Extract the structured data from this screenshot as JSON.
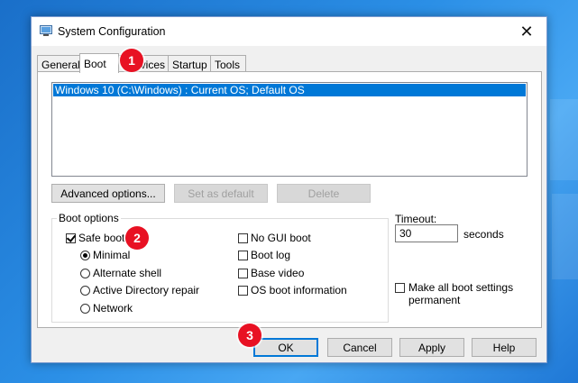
{
  "window": {
    "title": "System Configuration",
    "close_glyph": "✕"
  },
  "tabs": [
    {
      "label": "General",
      "active": false
    },
    {
      "label": "Boot",
      "active": true
    },
    {
      "label": "Services",
      "active": false
    },
    {
      "label": "Startup",
      "active": false
    },
    {
      "label": "Tools",
      "active": false
    }
  ],
  "os_list": {
    "items": [
      "Windows 10 (C:\\Windows) : Current OS; Default OS"
    ],
    "selected_index": 0
  },
  "buttons": {
    "advanced": "Advanced options...",
    "set_default": "Set as default",
    "delete": "Delete"
  },
  "boot_options": {
    "label": "Boot options",
    "safe_boot": {
      "label": "Safe boot",
      "checked": true
    },
    "radios": [
      {
        "label": "Minimal",
        "checked": true
      },
      {
        "label": "Alternate shell",
        "checked": false
      },
      {
        "label": "Active Directory repair",
        "checked": false
      },
      {
        "label": "Network",
        "checked": false
      }
    ],
    "right_checks": [
      {
        "label": "No GUI boot",
        "checked": false
      },
      {
        "label": "Boot log",
        "checked": false
      },
      {
        "label": "Base video",
        "checked": false
      },
      {
        "label": "OS boot information",
        "checked": false
      }
    ]
  },
  "timeout": {
    "label": "Timeout:",
    "value": "30",
    "unit": "seconds"
  },
  "make_permanent": {
    "line1": "Make all boot settings",
    "line2": "permanent",
    "checked": false
  },
  "footer": {
    "ok": "OK",
    "cancel": "Cancel",
    "apply": "Apply",
    "help": "Help"
  },
  "badges": [
    "1",
    "2",
    "3"
  ],
  "colors": {
    "selection": "#0078d7",
    "badge": "#e81123"
  }
}
